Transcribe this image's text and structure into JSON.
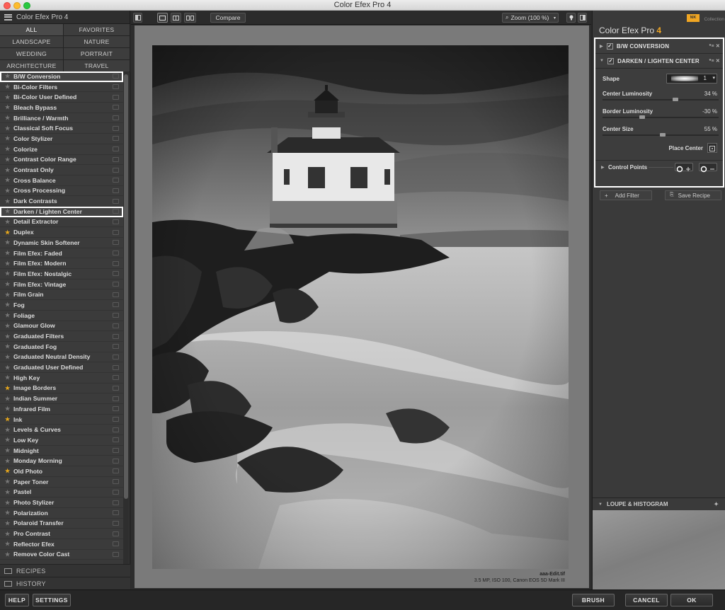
{
  "window": {
    "title": "Color Efex Pro 4"
  },
  "left_panel": {
    "header": "Color Efex Pro 4",
    "categories": [
      "ALL",
      "FAVORITES",
      "LANDSCAPE",
      "NATURE",
      "WEDDING",
      "PORTRAIT",
      "ARCHITECTURE",
      "TRAVEL"
    ],
    "active_category": "ALL",
    "filters": [
      {
        "label": "B/W Conversion",
        "fav": false,
        "highlighted": true
      },
      {
        "label": "Bi-Color Filters",
        "fav": false
      },
      {
        "label": "Bi-Color User Defined",
        "fav": false
      },
      {
        "label": "Bleach Bypass",
        "fav": false
      },
      {
        "label": "Brilliance / Warmth",
        "fav": false
      },
      {
        "label": "Classical Soft Focus",
        "fav": false
      },
      {
        "label": "Color Stylizer",
        "fav": false
      },
      {
        "label": "Colorize",
        "fav": false
      },
      {
        "label": "Contrast Color Range",
        "fav": false
      },
      {
        "label": "Contrast Only",
        "fav": false
      },
      {
        "label": "Cross Balance",
        "fav": false
      },
      {
        "label": "Cross Processing",
        "fav": false
      },
      {
        "label": "Dark Contrasts",
        "fav": false
      },
      {
        "label": "Darken / Lighten Center",
        "fav": false,
        "highlighted": true
      },
      {
        "label": "Detail Extractor",
        "fav": false
      },
      {
        "label": "Duplex",
        "fav": true
      },
      {
        "label": "Dynamic Skin Softener",
        "fav": false
      },
      {
        "label": "Film Efex: Faded",
        "fav": false
      },
      {
        "label": "Film Efex: Modern",
        "fav": false
      },
      {
        "label": "Film Efex: Nostalgic",
        "fav": false
      },
      {
        "label": "Film Efex: Vintage",
        "fav": false
      },
      {
        "label": "Film Grain",
        "fav": false
      },
      {
        "label": "Fog",
        "fav": false
      },
      {
        "label": "Foliage",
        "fav": false
      },
      {
        "label": "Glamour Glow",
        "fav": false
      },
      {
        "label": "Graduated Filters",
        "fav": false
      },
      {
        "label": "Graduated Fog",
        "fav": false
      },
      {
        "label": "Graduated Neutral Density",
        "fav": false
      },
      {
        "label": "Graduated User Defined",
        "fav": false
      },
      {
        "label": "High Key",
        "fav": false
      },
      {
        "label": "Image Borders",
        "fav": true
      },
      {
        "label": "Indian Summer",
        "fav": false
      },
      {
        "label": "Infrared Film",
        "fav": false
      },
      {
        "label": "Ink",
        "fav": true
      },
      {
        "label": "Levels & Curves",
        "fav": false
      },
      {
        "label": "Low Key",
        "fav": false
      },
      {
        "label": "Midnight",
        "fav": false
      },
      {
        "label": "Monday Morning",
        "fav": false
      },
      {
        "label": "Old Photo",
        "fav": true
      },
      {
        "label": "Paper Toner",
        "fav": false
      },
      {
        "label": "Pastel",
        "fav": false
      },
      {
        "label": "Photo Stylizer",
        "fav": false
      },
      {
        "label": "Polarization",
        "fav": false
      },
      {
        "label": "Polaroid Transfer",
        "fav": false
      },
      {
        "label": "Pro Contrast",
        "fav": false
      },
      {
        "label": "Reflector Efex",
        "fav": false
      },
      {
        "label": "Remove Color Cast",
        "fav": false
      }
    ],
    "recipes_label": "RECIPES",
    "history_label": "HISTORY"
  },
  "toolbar": {
    "compare_label": "Compare",
    "zoom_label": "Zoom (100 %)"
  },
  "image": {
    "filename": "aaa-Edit.tif",
    "meta": "3.5 MP, ISO 100, Canon EOS 5D Mark III"
  },
  "right_panel": {
    "brand": "Color Efex Pro",
    "brand_version": "4",
    "logo_text": "NIK",
    "collection": "Collection",
    "bw_filter": "B/W CONVERSION",
    "center_filter": "DARKEN / LIGHTEN CENTER",
    "shape_label": "Shape",
    "shape_value": "1",
    "params": [
      {
        "label": "Center Luminosity",
        "value": "34 %",
        "level": 0.67
      },
      {
        "label": "Border Luminosity",
        "value": "-30 %",
        "level": 0.35
      },
      {
        "label": "Center Size",
        "value": "55 %",
        "level": 0.55
      }
    ],
    "place_center": "Place Center",
    "control_points": "Control Points",
    "add_filter": "Add Filter",
    "save_recipe": "Save Recipe",
    "loupe_label": "LOUPE & HISTOGRAM"
  },
  "bottom_bar": {
    "help": "HELP",
    "settings": "SETTINGS",
    "brush": "BRUSH",
    "cancel": "CANCEL",
    "ok": "OK"
  }
}
